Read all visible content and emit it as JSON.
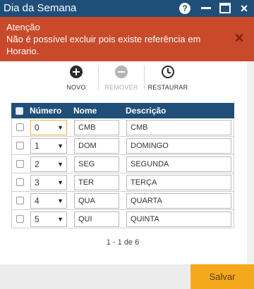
{
  "window": {
    "title": "Dia da Semana",
    "help_label": "?",
    "close_label": "×"
  },
  "alert": {
    "title": "Atenção",
    "message": "Não é possível excluir pois existe referência em Horario.",
    "close_label": "×",
    "color": "#c94a2a"
  },
  "toolbar": {
    "new_label": "NOVO",
    "remove_label": "REMOVER",
    "restore_label": "RESTAURAR"
  },
  "table": {
    "headers": [
      "Número",
      "Nome",
      "Descrição"
    ],
    "rows": [
      {
        "numero": "0",
        "nome": "CMB",
        "descricao": "CMB"
      },
      {
        "numero": "1",
        "nome": "DOM",
        "descricao": "DOMINGO"
      },
      {
        "numero": "2",
        "nome": "SEG",
        "descricao": "SEGUNDA"
      },
      {
        "numero": "3",
        "nome": "TER",
        "descricao": "TERÇA"
      },
      {
        "numero": "4",
        "nome": "QUA",
        "descricao": "QUARTA"
      },
      {
        "numero": "5",
        "nome": "QUI",
        "descricao": "QUINTA"
      }
    ],
    "header_color": "#1f4e79"
  },
  "pager": {
    "text": "1 - 1 de 6"
  },
  "footer": {
    "save_label": "Salvar",
    "save_color": "#f3a91b"
  },
  "icons": [
    "help-icon",
    "minimize-icon",
    "maximize-icon",
    "close-icon",
    "add-icon",
    "remove-icon",
    "restore-icon",
    "chevron-down-icon"
  ]
}
